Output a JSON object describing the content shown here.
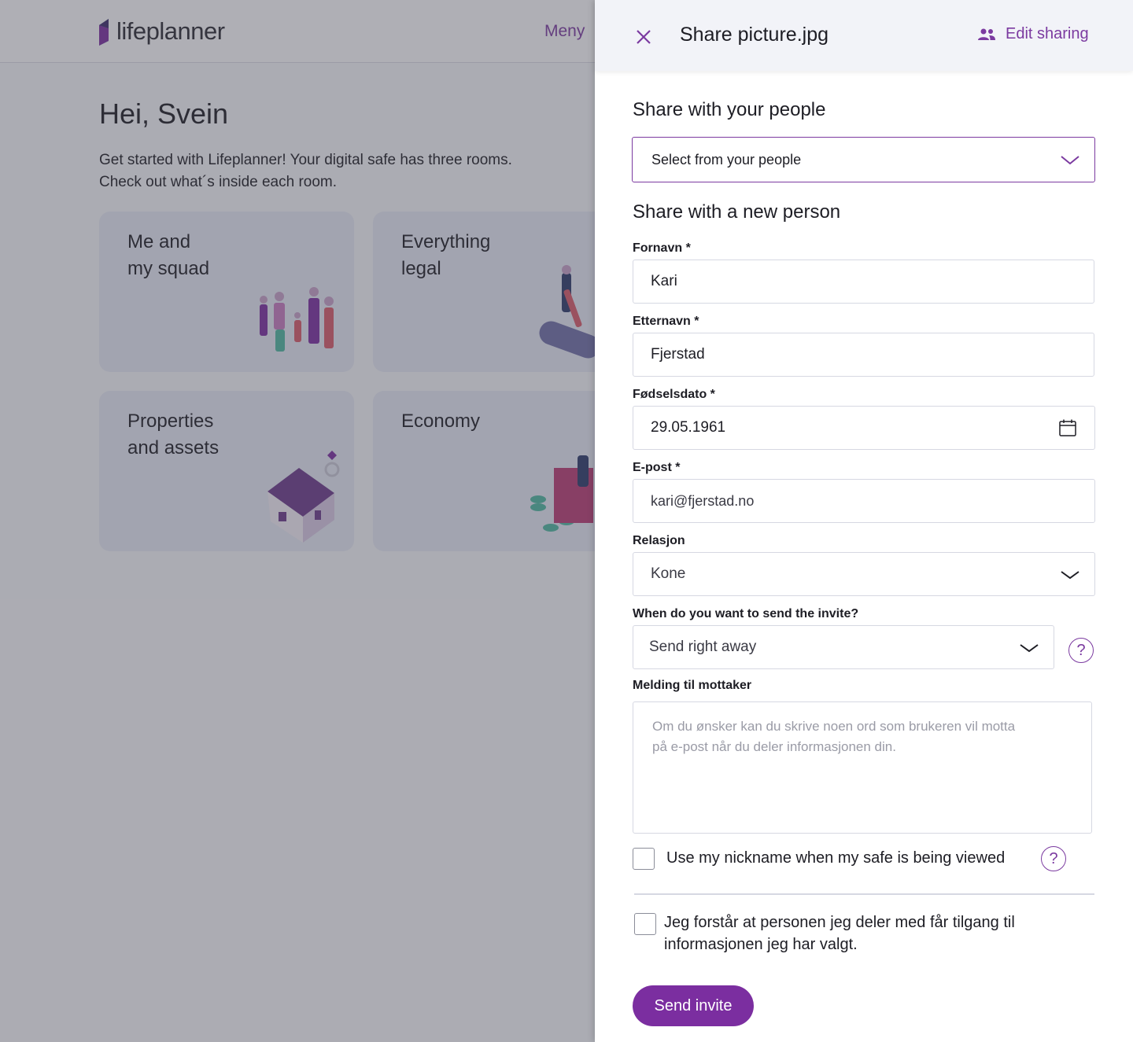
{
  "background": {
    "logo_text": "lifeplanner",
    "menu_label": "Meny",
    "greeting": "Hei, Svein",
    "intro_line1": "Get started with Lifeplanner! Your digital safe has three rooms.",
    "intro_line2": "Check out what´s inside each room.",
    "cards": [
      {
        "title": "Me and\nmy squad"
      },
      {
        "title": "Everything\nlegal"
      },
      {
        "title": "Properties\nand assets"
      },
      {
        "title": "Economy"
      }
    ]
  },
  "panel": {
    "title": "Share picture.jpg",
    "edit_sharing_label": "Edit sharing",
    "share_people_heading": "Share with your people",
    "people_select_value": "Select from your people",
    "new_person_heading": "Share with a new person",
    "fields": {
      "first_name": {
        "label": "Fornavn *",
        "value": "Kari"
      },
      "last_name": {
        "label": "Etternavn *",
        "value": "Fjerstad"
      },
      "birth_date": {
        "label": "Fødselsdato *",
        "value": "29.05.1961"
      },
      "email": {
        "label": "E-post *",
        "value": "kari@fjerstad.no"
      },
      "relation": {
        "label": "Relasjon",
        "value": "Kone"
      },
      "invite_time": {
        "label": "When do you want to send the invite?",
        "value": "Send right away"
      },
      "message": {
        "label": "Melding til mottaker",
        "placeholder_line1": "Om du ønsker kan du skrive noen ord som brukeren vil motta",
        "placeholder_line2": "på e-post når du deler informasjonen din."
      }
    },
    "nickname_label": "Use my nickname when my safe is being viewed",
    "consent_line1": "Jeg forstår at personen jeg deler med får tilgang til",
    "consent_line2": "informasjonen jeg har valgt.",
    "send_button": "Send invite"
  },
  "colors": {
    "accent": "#7b2ea0",
    "teal": "#4fb7a0",
    "card_bg": "#e6e9f5"
  }
}
